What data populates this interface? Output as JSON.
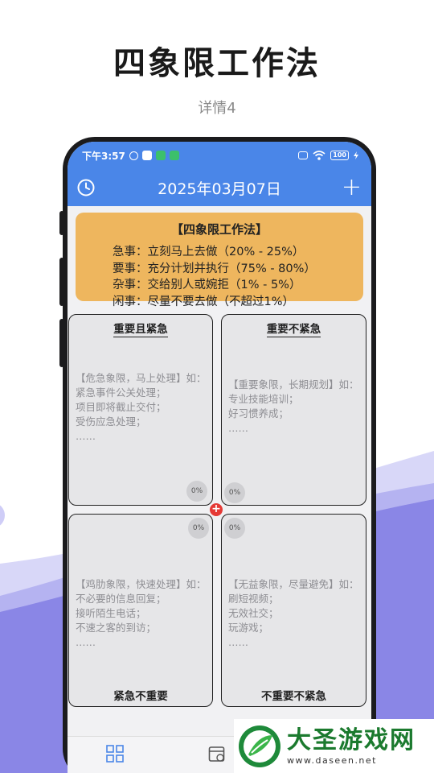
{
  "promo": {
    "title": "四象限工作法",
    "subtitle": "详情4"
  },
  "status_bar": {
    "time": "下午3:57",
    "battery": "100"
  },
  "app_bar": {
    "date": "2025年03月07日",
    "left_icon": "clock-icon",
    "right_icon": "plus-icon",
    "right_label": "+"
  },
  "info_card": {
    "title": "【四象限工作法】",
    "lines": [
      "急事：立刻马上去做（20% - 25%）",
      "要事：充分计划并执行（75% - 80%）",
      "杂事：交给别人或婉拒（1% - 5%）",
      "闲事：尽量不要去做（不超过1%）"
    ]
  },
  "quadrants": [
    {
      "title": "重要且紧急",
      "lines": [
        "【危急象限，马上处理】如：",
        "紧急事件公关处理；",
        "项目即将截止交付；",
        "受伤应急处理；",
        "……"
      ],
      "progress": "0%"
    },
    {
      "title": "重要不紧急",
      "lines": [
        "【重要象限，长期规划】如：",
        "专业技能培训；",
        "好习惯养成；",
        "……"
      ],
      "progress": "0%"
    },
    {
      "title": "紧急不重要",
      "lines": [
        "【鸡肋象限，快速处理】如：",
        "不必要的信息回复；",
        "接听陌生电话；",
        "不速之客的到访；",
        "……"
      ],
      "progress": "0%"
    },
    {
      "title": "不重要不紧急",
      "lines": [
        "【无益象限，尽量避免】如：",
        "刷短视频；",
        "无效社交；",
        "玩游戏；",
        "……"
      ],
      "progress": "0%"
    }
  ],
  "center_button": "+",
  "watermark": {
    "name": "大圣游戏网",
    "url": "www.daseen.net"
  },
  "colors": {
    "accent": "#4a86e8",
    "card": "#eeb65e",
    "quad_bg": "#e6e6e8",
    "center_dot": "#e53935",
    "watermark_green": "#1b7a2e"
  }
}
